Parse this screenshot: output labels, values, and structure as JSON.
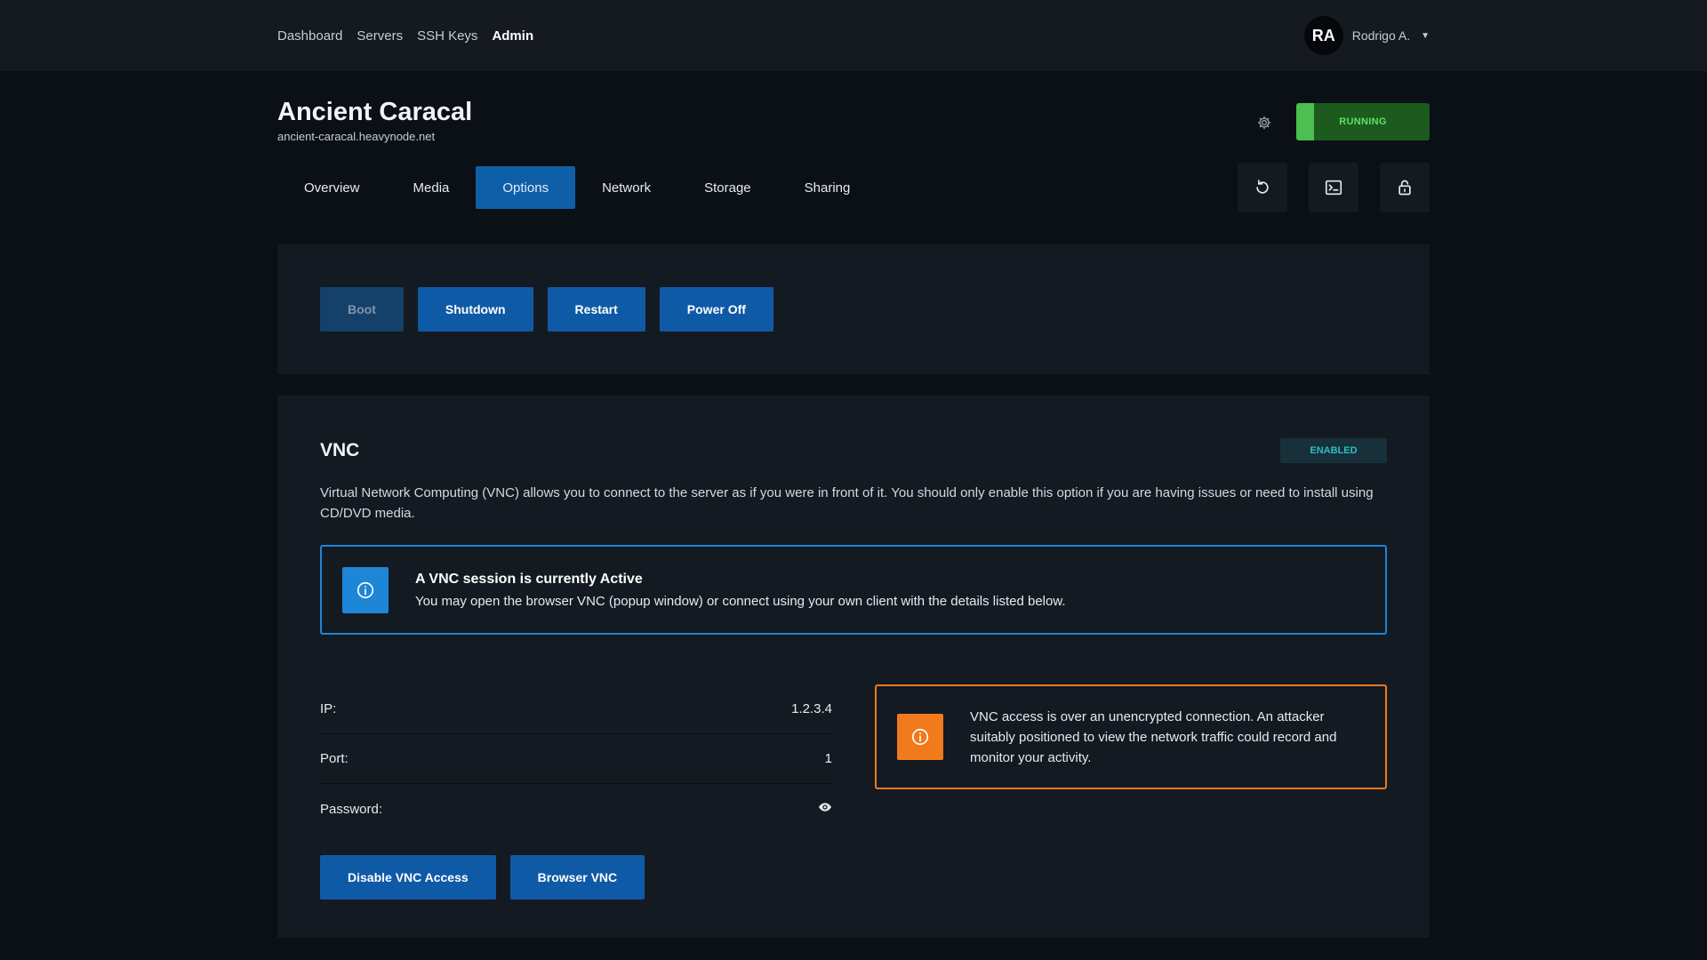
{
  "nav": {
    "links": [
      {
        "label": "Dashboard",
        "active": false
      },
      {
        "label": "Servers",
        "active": false
      },
      {
        "label": "SSH Keys",
        "active": false
      },
      {
        "label": "Admin",
        "active": true
      }
    ],
    "user": {
      "initials": "RA",
      "name": "Rodrigo A."
    }
  },
  "server": {
    "title": "Ancient Caracal",
    "hostname": "ancient-caracal.heavynode.net",
    "status": "RUNNING"
  },
  "tabs": [
    {
      "label": "Overview",
      "active": false
    },
    {
      "label": "Media",
      "active": false
    },
    {
      "label": "Options",
      "active": true
    },
    {
      "label": "Network",
      "active": false
    },
    {
      "label": "Storage",
      "active": false
    },
    {
      "label": "Sharing",
      "active": false
    }
  ],
  "toolbar_icons": [
    "gear-icon",
    "refresh-icon",
    "terminal-icon",
    "lock-icon"
  ],
  "power": {
    "boot": "Boot",
    "shutdown": "Shutdown",
    "restart": "Restart",
    "power_off": "Power Off"
  },
  "vnc": {
    "title": "VNC",
    "badge": "ENABLED",
    "description": "Virtual Network Computing (VNC) allows you to connect to the server as if you were in front of it. You should only enable this option if you are having issues or need to install using CD/DVD media.",
    "session_alert": {
      "title": "A VNC session is currently Active",
      "body": "You may open the browser VNC (popup window) or connect using your own client with the details listed below."
    },
    "details": {
      "ip_label": "IP:",
      "ip_value": "1.2.3.4",
      "port_label": "Port:",
      "port_value": "1",
      "password_label": "Password:"
    },
    "warning": "VNC access is over an unencrypted connection. An attacker suitably positioned to view the network traffic could record and monitor your activity.",
    "disable_button": "Disable VNC Access",
    "browser_button": "Browser VNC"
  },
  "colors": {
    "primary": "#0f5aa6",
    "info": "#1e86d6",
    "warning": "#f07a1c",
    "running": "#4bbf4f",
    "enabled": "#2bbfc2"
  }
}
